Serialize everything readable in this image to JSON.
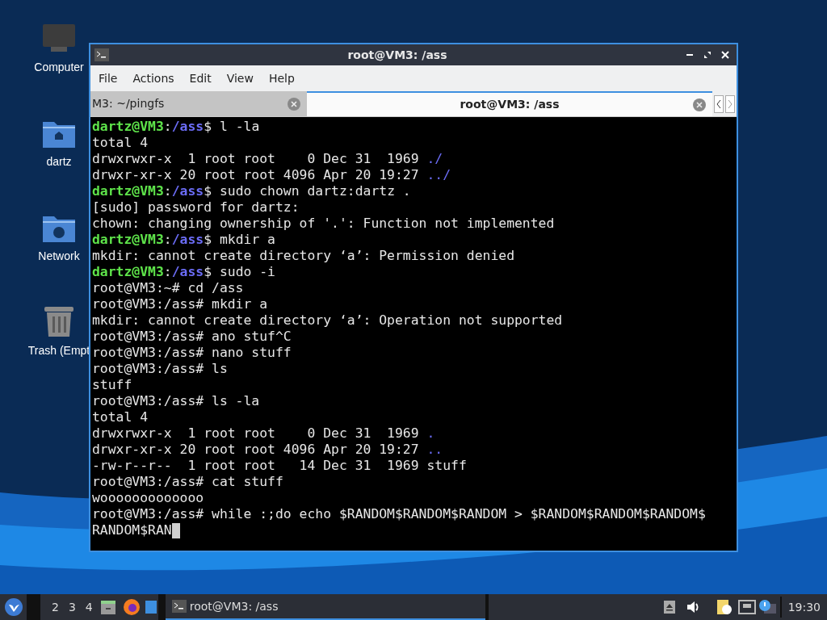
{
  "desktop_icons": [
    {
      "kind": "computer",
      "label": "Computer"
    },
    {
      "kind": "home",
      "label": "dartz"
    },
    {
      "kind": "network",
      "label": "Network"
    },
    {
      "kind": "trash",
      "label": "Trash (Empt"
    }
  ],
  "window": {
    "title": "root@VM3: /ass",
    "menu": [
      "File",
      "Actions",
      "Edit",
      "View",
      "Help"
    ],
    "tabs": [
      {
        "label": "M3: ~/pingfs",
        "selected": false
      },
      {
        "label": "root@VM3: /ass",
        "selected": true
      }
    ],
    "terminal": {
      "cursor_visible": true,
      "lines": [
        [
          {
            "kind": "user",
            "text": "dartz@VM3"
          },
          {
            "kind": "plain",
            "text": ":"
          },
          {
            "kind": "path",
            "text": "/ass"
          },
          {
            "kind": "plain",
            "text": "$ l -la"
          }
        ],
        [
          {
            "kind": "plain",
            "text": "total 4"
          }
        ],
        [
          {
            "kind": "plain",
            "text": "drwxrwxr-x  1 root root    0 Dec 31  1969 "
          },
          {
            "kind": "dir",
            "text": "./"
          }
        ],
        [
          {
            "kind": "plain",
            "text": "drwxr-xr-x 20 root root 4096 Apr 20 19:27 "
          },
          {
            "kind": "dir",
            "text": "../"
          }
        ],
        [
          {
            "kind": "user",
            "text": "dartz@VM3"
          },
          {
            "kind": "plain",
            "text": ":"
          },
          {
            "kind": "path",
            "text": "/ass"
          },
          {
            "kind": "plain",
            "text": "$ sudo chown dartz:dartz ."
          }
        ],
        [
          {
            "kind": "plain",
            "text": "[sudo] password for dartz:"
          }
        ],
        [
          {
            "kind": "plain",
            "text": "chown: changing ownership of '.': Function not implemented"
          }
        ],
        [
          {
            "kind": "user",
            "text": "dartz@VM3"
          },
          {
            "kind": "plain",
            "text": ":"
          },
          {
            "kind": "path",
            "text": "/ass"
          },
          {
            "kind": "plain",
            "text": "$ mkdir a"
          }
        ],
        [
          {
            "kind": "plain",
            "text": "mkdir: cannot create directory ‘a’: Permission denied"
          }
        ],
        [
          {
            "kind": "user",
            "text": "dartz@VM3"
          },
          {
            "kind": "plain",
            "text": ":"
          },
          {
            "kind": "path",
            "text": "/ass"
          },
          {
            "kind": "plain",
            "text": "$ sudo -i"
          }
        ],
        [
          {
            "kind": "plain",
            "text": "root@VM3:~# cd /ass"
          }
        ],
        [
          {
            "kind": "plain",
            "text": "root@VM3:/ass# mkdir a"
          }
        ],
        [
          {
            "kind": "plain",
            "text": "mkdir: cannot create directory ‘a’: Operation not supported"
          }
        ],
        [
          {
            "kind": "plain",
            "text": "root@VM3:/ass# ano stuf^C"
          }
        ],
        [
          {
            "kind": "plain",
            "text": "root@VM3:/ass# nano stuff"
          }
        ],
        [
          {
            "kind": "plain",
            "text": "root@VM3:/ass# ls"
          }
        ],
        [
          {
            "kind": "plain",
            "text": "stuff"
          }
        ],
        [
          {
            "kind": "plain",
            "text": "root@VM3:/ass# ls -la"
          }
        ],
        [
          {
            "kind": "plain",
            "text": "total 4"
          }
        ],
        [
          {
            "kind": "plain",
            "text": "drwxrwxr-x  1 root root    0 Dec 31  1969 "
          },
          {
            "kind": "dir",
            "text": "."
          }
        ],
        [
          {
            "kind": "plain",
            "text": "drwxr-xr-x 20 root root 4096 Apr 20 19:27 "
          },
          {
            "kind": "dir",
            "text": ".."
          }
        ],
        [
          {
            "kind": "plain",
            "text": "-rw-r--r--  1 root root   14 Dec 31  1969 stuff"
          }
        ],
        [
          {
            "kind": "plain",
            "text": "root@VM3:/ass# cat stuff"
          }
        ],
        [
          {
            "kind": "plain",
            "text": "wooooooooooooo"
          }
        ],
        [
          {
            "kind": "plain",
            "text": "root@VM3:/ass# while :;do echo $RANDOM$RANDOM$RANDOM > $RANDOM$RANDOM$RANDOM$"
          }
        ],
        [
          {
            "kind": "plain",
            "text": "RANDOM$RAN"
          }
        ]
      ]
    }
  },
  "taskbar": {
    "workspaces": [
      "2",
      "3",
      "4"
    ],
    "task": "root@VM3: /ass",
    "clock": "19:30"
  }
}
